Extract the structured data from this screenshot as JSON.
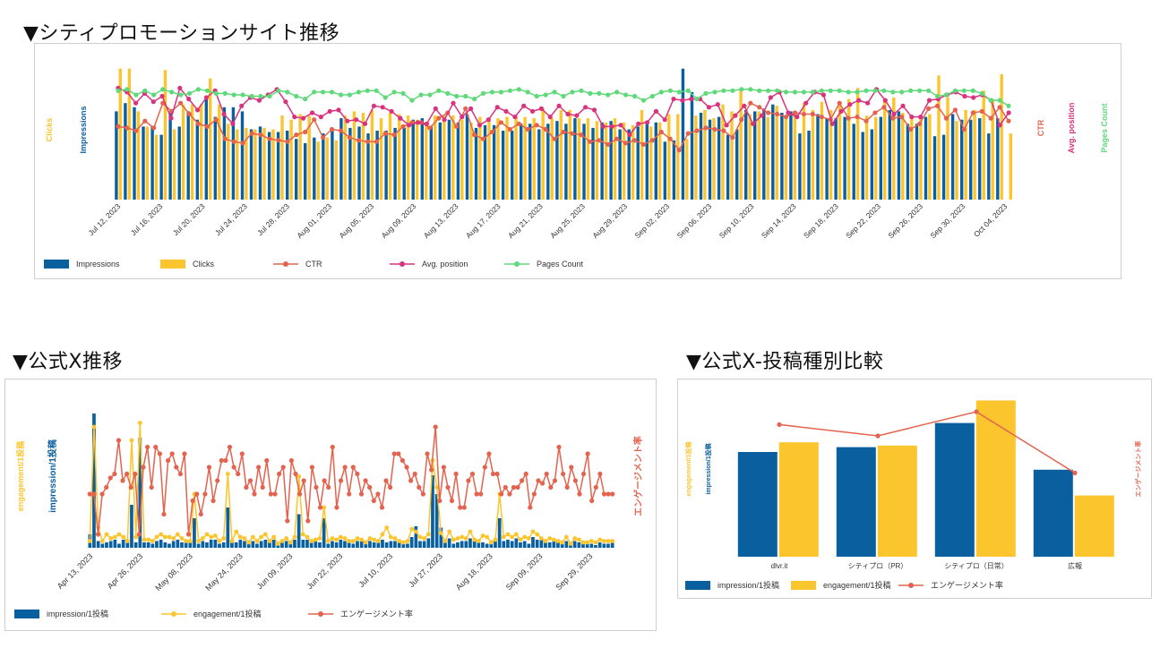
{
  "sections": {
    "s1_title": "▼シティプロモーションサイト推移",
    "s2_title": "▼公式X推移",
    "s3_title": "▼公式X-投稿種別比較"
  },
  "colors": {
    "impressions": "#0a5f9e",
    "clicks": "#fbc52e",
    "ctr": "#e4634f",
    "avg_position": "#d9327f",
    "pages_count": "#5fd97a",
    "engagement_rate": "#e4634f"
  },
  "chart_data": [
    {
      "id": "site",
      "type": "bar",
      "x_tick_labels": [
        "Jul 12, 2023",
        "Jul 16, 2023",
        "Jul 20, 2023",
        "Jul 24, 2023",
        "Jul 28, 2023",
        "Aug 01, 2023",
        "Aug 05, 2023",
        "Aug 09, 2023",
        "Aug 13, 2023",
        "Aug 17, 2023",
        "Aug 21, 2023",
        "Aug 25, 2023",
        "Aug 29, 2023",
        "Sep 02, 2023",
        "Sep 06, 2023",
        "Sep 10, 2023",
        "Sep 14, 2023",
        "Sep 18, 2023",
        "Sep 22, 2023",
        "Sep 26, 2023",
        "Sep 30, 2023",
        "Oct 04, 2023"
      ],
      "axis_labels": {
        "left1": "Clicks",
        "left2": "Impressions",
        "right1": "CTR",
        "right2": "Avg. position",
        "right3": "Pages Count"
      },
      "legend_position": "bottom-left",
      "series": [
        {
          "name": "Impressions",
          "type": "bar",
          "values": [
            64,
            70,
            67,
            53,
            53,
            47,
            63,
            53,
            64,
            58,
            73,
            60,
            67,
            67,
            64,
            51,
            53,
            49,
            49,
            50,
            44,
            41,
            45,
            48,
            51,
            59,
            52,
            53,
            48,
            50,
            50,
            52,
            52,
            58,
            59,
            53,
            56,
            58,
            56,
            62,
            52,
            54,
            54,
            50,
            50,
            55,
            55,
            51,
            55,
            57,
            55,
            59,
            55,
            52,
            56,
            57,
            51,
            51,
            53,
            56,
            56,
            42,
            43,
            95,
            78,
            63,
            58,
            60,
            47,
            51,
            65,
            64,
            66,
            69,
            63,
            64,
            48,
            50,
            62,
            59,
            59,
            60,
            55,
            49,
            51,
            60,
            65,
            64,
            55,
            55,
            60,
            46,
            47,
            62,
            58,
            58,
            59,
            48,
            59
          ],
          "ymax": 100
        },
        {
          "name": "Clicks",
          "type": "bar",
          "values": [
            95,
            95,
            64,
            53,
            47,
            94,
            51,
            69,
            69,
            69,
            88,
            69,
            55,
            51,
            52,
            51,
            52,
            51,
            61,
            58,
            62,
            61,
            42,
            45,
            43,
            61,
            64,
            63,
            65,
            59,
            63,
            62,
            61,
            58,
            56,
            61,
            61,
            61,
            58,
            56,
            60,
            59,
            59,
            60,
            60,
            60,
            59,
            66,
            59,
            65,
            65,
            59,
            59,
            57,
            56,
            59,
            56,
            54,
            65,
            53,
            56,
            62,
            62,
            44,
            61,
            65,
            59,
            69,
            64,
            81,
            62,
            64,
            60,
            68,
            61,
            62,
            70,
            65,
            71,
            65,
            69,
            73,
            81,
            61,
            60,
            72,
            74,
            63,
            61,
            59,
            62,
            90,
            74,
            57,
            65,
            65,
            79,
            73,
            91,
            48
          ],
          "ymax": 100
        },
        {
          "name": "CTR",
          "type": "line",
          "values": [
            53,
            52,
            50,
            57,
            52,
            70,
            64,
            70,
            62,
            55,
            53,
            58,
            44,
            42,
            41,
            48,
            47,
            44,
            43,
            42,
            47,
            49,
            58,
            45,
            51,
            50,
            45,
            43,
            42,
            42,
            48,
            47,
            53,
            56,
            56,
            52,
            59,
            63,
            53,
            66,
            47,
            44,
            49,
            56,
            51,
            55,
            51,
            54,
            51,
            44,
            49,
            48,
            47,
            42,
            43,
            40,
            44,
            41,
            43,
            40,
            43,
            49,
            44,
            36,
            48,
            50,
            52,
            51,
            50,
            45,
            58,
            70,
            67,
            63,
            62,
            60,
            63,
            62,
            62,
            60,
            58,
            70,
            59,
            60,
            57,
            63,
            67,
            59,
            60,
            51,
            55,
            66,
            68,
            59,
            65,
            51,
            63,
            64,
            59,
            67,
            57
          ],
          "ymax": 100
        },
        {
          "name": "Avg. position",
          "type": "line",
          "values": [
            81,
            78,
            70,
            77,
            71,
            75,
            59,
            81,
            73,
            65,
            74,
            79,
            62,
            55,
            68,
            74,
            72,
            76,
            80,
            71,
            60,
            59,
            63,
            60,
            64,
            65,
            57,
            58,
            55,
            68,
            67,
            64,
            59,
            54,
            56,
            55,
            66,
            58,
            70,
            60,
            66,
            54,
            58,
            67,
            64,
            60,
            68,
            64,
            66,
            60,
            68,
            62,
            61,
            67,
            65,
            53,
            53,
            54,
            47,
            55,
            56,
            64,
            58,
            73,
            72,
            73,
            73,
            67,
            69,
            54,
            61,
            68,
            55,
            61,
            74,
            78,
            63,
            60,
            70,
            78,
            76,
            55,
            64,
            69,
            72,
            70,
            80,
            72,
            62,
            68,
            60,
            60,
            72,
            73,
            76,
            78,
            75,
            74,
            76,
            72,
            54,
            63
          ],
          "ymax": 100
        },
        {
          "name": "Pages Count",
          "type": "line",
          "values": [
            79,
            80,
            76,
            79,
            76,
            80,
            78,
            76,
            77,
            80,
            79,
            77,
            77,
            76,
            76,
            75,
            75,
            75,
            79,
            78,
            75,
            73,
            78,
            78,
            78,
            76,
            76,
            78,
            79,
            79,
            74,
            78,
            77,
            72,
            76,
            76,
            79,
            77,
            75,
            75,
            73,
            77,
            78,
            78,
            79,
            80,
            78,
            75,
            76,
            78,
            75,
            78,
            79,
            77,
            77,
            76,
            78,
            76,
            75,
            72,
            75,
            78,
            79,
            78,
            79,
            73,
            77,
            78,
            79,
            79,
            80,
            80,
            79,
            79,
            79,
            78,
            78,
            78,
            78,
            79,
            79,
            79,
            78,
            78,
            79,
            79,
            79,
            78,
            78,
            79,
            79,
            79,
            75,
            76,
            79,
            79,
            79,
            77,
            72,
            72,
            68
          ],
          "ymax": 100
        }
      ]
    },
    {
      "id": "x_trend",
      "type": "bar",
      "x_tick_labels": [
        "Apr 13, 2023",
        "Apr 26, 2023",
        "May 08, 2023",
        "May 24, 2023",
        "Jun 09, 2023",
        "Jun 22, 2023",
        "Jul 10, 2023",
        "Jul 27, 2023",
        "Aug 18, 2023",
        "Sep 09, 2023",
        "Sep 29, 2023"
      ],
      "axis_labels": {
        "left1": "engagement/1投稿",
        "left2": "impression/1投稿",
        "right1": "エンゲージメント率"
      },
      "legend_position": "bottom-left",
      "series": [
        {
          "name": "impression/1投稿",
          "type": "bar",
          "values": [
            10,
            100,
            5,
            3,
            4,
            5,
            6,
            3,
            6,
            5,
            32,
            4,
            82,
            4,
            4,
            3,
            5,
            6,
            4,
            3,
            5,
            6,
            4,
            5,
            5,
            22,
            3,
            5,
            4,
            6,
            6,
            3,
            4,
            30,
            5,
            4,
            6,
            5,
            4,
            5,
            3,
            5,
            6,
            4,
            6,
            2,
            4,
            5,
            3,
            6,
            25,
            6,
            6,
            4,
            5,
            4,
            22,
            3,
            5,
            4,
            6,
            5,
            4,
            3,
            5,
            5,
            4,
            5,
            4,
            5,
            6,
            4,
            5,
            5,
            6,
            4,
            3,
            8,
            16,
            5,
            5,
            7,
            54,
            40,
            15,
            5,
            7,
            3,
            4,
            5,
            5,
            7,
            6,
            5,
            4,
            3,
            3,
            5,
            22,
            5,
            6,
            5,
            7,
            4,
            5,
            3,
            8,
            6,
            6,
            4,
            4,
            5,
            4,
            3,
            5,
            2,
            5,
            4,
            3,
            3,
            3,
            2,
            4,
            3,
            3,
            4
          ],
          "ymax": 100
        },
        {
          "name": "engagement/1投稿",
          "type": "line",
          "values": [
            5,
            90,
            15,
            5,
            10,
            7,
            8,
            10,
            8,
            5,
            80,
            8,
            93,
            6,
            6,
            5,
            8,
            10,
            8,
            8,
            7,
            10,
            7,
            5,
            5,
            40,
            5,
            7,
            10,
            8,
            9,
            5,
            7,
            55,
            5,
            12,
            8,
            7,
            4,
            8,
            5,
            8,
            10,
            5,
            8,
            3,
            5,
            7,
            4,
            8,
            53,
            10,
            8,
            5,
            6,
            7,
            30,
            5,
            7,
            6,
            8,
            7,
            5,
            5,
            7,
            6,
            4,
            7,
            6,
            5,
            10,
            15,
            8,
            7,
            5,
            4,
            5,
            14,
            12,
            8,
            7,
            10,
            65,
            45,
            11,
            5,
            12,
            6,
            7,
            8,
            7,
            12,
            6,
            5,
            9,
            8,
            4,
            6,
            40,
            8,
            10,
            8,
            10,
            6,
            8,
            7,
            12,
            10,
            7,
            5,
            7,
            6,
            5,
            4,
            8,
            3,
            7,
            6,
            4,
            4,
            5,
            4,
            6,
            5,
            5,
            5
          ],
          "ymax": 100
        },
        {
          "name": "エンゲージメント率",
          "type": "line",
          "values": [
            40,
            40,
            10,
            40,
            45,
            52,
            55,
            80,
            50,
            55,
            45,
            55,
            10,
            60,
            75,
            45,
            75,
            70,
            25,
            65,
            70,
            60,
            55,
            70,
            10,
            35,
            40,
            25,
            40,
            60,
            35,
            50,
            65,
            65,
            75,
            60,
            55,
            70,
            45,
            50,
            40,
            60,
            45,
            65,
            40,
            40,
            55,
            60,
            20,
            65,
            55,
            40,
            50,
            20,
            60,
            45,
            30,
            50,
            45,
            75,
            30,
            50,
            60,
            40,
            60,
            55,
            40,
            50,
            45,
            35,
            40,
            30,
            50,
            45,
            70,
            70,
            65,
            60,
            50,
            55,
            45,
            40,
            70,
            58,
            90,
            35,
            60,
            45,
            35,
            55,
            30,
            30,
            50,
            55,
            40,
            40,
            60,
            70,
            55,
            55,
            40,
            45,
            40,
            45,
            45,
            50,
            55,
            30,
            40,
            50,
            48,
            55,
            45,
            50,
            75,
            55,
            45,
            60,
            50,
            40,
            55,
            70,
            35,
            45,
            55,
            40,
            40,
            40
          ],
          "ymax": 100
        }
      ]
    },
    {
      "id": "x_post_type",
      "type": "bar",
      "categories": [
        "dlvr.it",
        "シティプロ（PR）",
        "シティプロ（日常）",
        "広報"
      ],
      "axis_labels": {
        "left1": "engagement/1投稿",
        "left2": "impression/1投稿",
        "right1": "エンゲージメント率"
      },
      "legend_position": "bottom-left",
      "series": [
        {
          "name": "impression/1投稿",
          "type": "bar",
          "values": [
            65,
            68,
            83,
            54
          ],
          "ymax": 100
        },
        {
          "name": "engagement/1投稿",
          "type": "bar",
          "values": [
            71,
            69,
            97,
            38
          ],
          "ymax": 100
        },
        {
          "name": "エンゲージメント率",
          "type": "line",
          "values": [
            82,
            75,
            90,
            52
          ],
          "ymax": 100
        }
      ]
    }
  ]
}
